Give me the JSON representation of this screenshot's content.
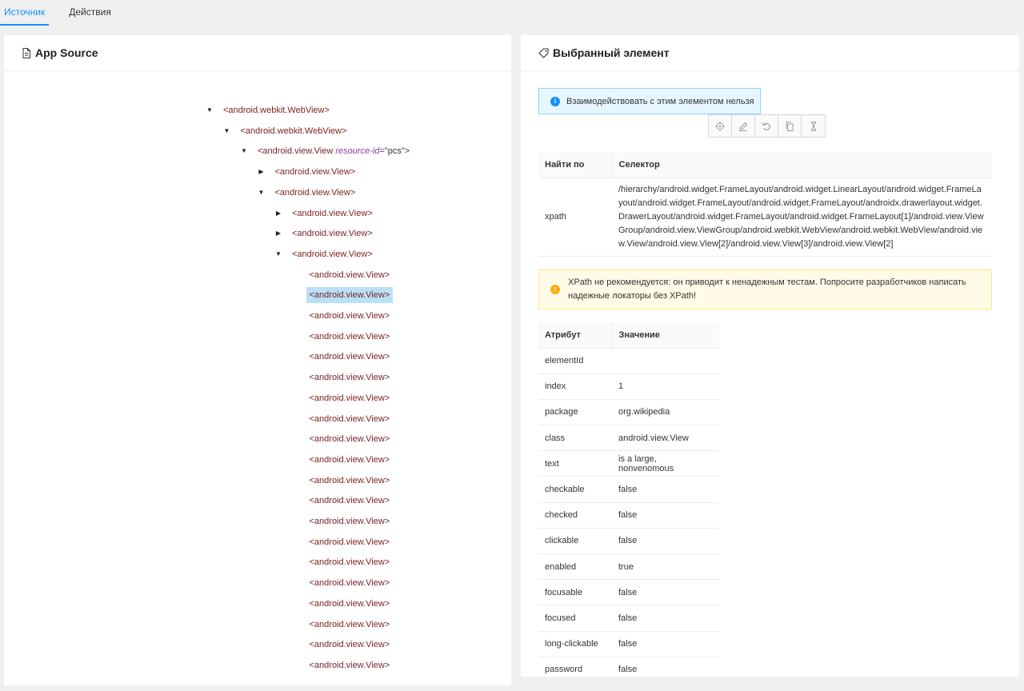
{
  "tabs": [
    {
      "label": "Источник",
      "active": true
    },
    {
      "label": "Действия",
      "active": false
    }
  ],
  "left_panel": {
    "title": "App Source",
    "tree": [
      {
        "tag": "<android.webkit.WebView>",
        "depth": 0,
        "caret": "down"
      },
      {
        "tag": "<android.webkit.WebView>",
        "depth": 1,
        "caret": "down"
      },
      {
        "tag": "<android.view.View",
        "attr_name": "resource-id",
        "attr_value": "=\"pcs\"",
        "close": ">",
        "depth": 2,
        "caret": "down"
      },
      {
        "tag": "<android.view.View>",
        "depth": 3,
        "caret": "right"
      },
      {
        "tag": "<android.view.View>",
        "depth": 3,
        "caret": "down"
      },
      {
        "tag": "<android.view.View>",
        "depth": 4,
        "caret": "right"
      },
      {
        "tag": "<android.view.View>",
        "depth": 4,
        "caret": "right"
      },
      {
        "tag": "<android.view.View>",
        "depth": 4,
        "caret": "down"
      },
      {
        "tag": "<android.view.View>",
        "depth": 5
      },
      {
        "tag": "<android.view.View>",
        "depth": 5,
        "selected": true
      },
      {
        "tag": "<android.view.View>",
        "depth": 5
      },
      {
        "tag": "<android.view.View>",
        "depth": 5
      },
      {
        "tag": "<android.view.View>",
        "depth": 5
      },
      {
        "tag": "<android.view.View>",
        "depth": 5
      },
      {
        "tag": "<android.view.View>",
        "depth": 5
      },
      {
        "tag": "<android.view.View>",
        "depth": 5
      },
      {
        "tag": "<android.view.View>",
        "depth": 5
      },
      {
        "tag": "<android.view.View>",
        "depth": 5
      },
      {
        "tag": "<android.view.View>",
        "depth": 5
      },
      {
        "tag": "<android.view.View>",
        "depth": 5
      },
      {
        "tag": "<android.view.View>",
        "depth": 5
      },
      {
        "tag": "<android.view.View>",
        "depth": 5
      },
      {
        "tag": "<android.view.View>",
        "depth": 5
      },
      {
        "tag": "<android.view.View>",
        "depth": 5
      },
      {
        "tag": "<android.view.View>",
        "depth": 5
      },
      {
        "tag": "<android.view.View>",
        "depth": 5
      },
      {
        "tag": "<android.view.View>",
        "depth": 5
      },
      {
        "tag": "<android.view.View>",
        "depth": 5
      }
    ]
  },
  "right_panel": {
    "title": "Выбранный элемент",
    "info_message": "Взаимодействовать с этим элементом нельзя",
    "toolbar": [
      "crosshair-icon",
      "pencil-icon",
      "undo-icon",
      "copy-icon",
      "hourglass-icon"
    ],
    "selector_table": {
      "headers": [
        "Найти по",
        "Селектор"
      ],
      "rows": [
        {
          "by": "xpath",
          "value": "/hierarchy/android.widget.FrameLayout/android.widget.LinearLayout/android.widget.FrameLayout/android.widget.FrameLayout/android.widget.FrameLayout/androidx.drawerlayout.widget.DrawerLayout/android.widget.FrameLayout/android.widget.FrameLayout[1]/android.view.ViewGroup/android.view.ViewGroup/android.webkit.WebView/android.webkit.WebView/android.view.View/android.view.View[2]/android.view.View[3]/android.view.View[2]"
        }
      ]
    },
    "warning_message": "XPath не рекомендуется: он приводит к ненадежным тестам. Попросите разработчиков написать надежные локаторы без XPath!",
    "attr_table": {
      "headers": [
        "Атрибут",
        "Значение"
      ],
      "rows": [
        {
          "name": "elementId",
          "value": ""
        },
        {
          "name": "index",
          "value": "1"
        },
        {
          "name": "package",
          "value": "org.wikipedia"
        },
        {
          "name": "class",
          "value": "android.view.View"
        },
        {
          "name": "text",
          "value": "is a large, nonvenomous"
        },
        {
          "name": "checkable",
          "value": "false"
        },
        {
          "name": "checked",
          "value": "false"
        },
        {
          "name": "clickable",
          "value": "false"
        },
        {
          "name": "enabled",
          "value": "true"
        },
        {
          "name": "focusable",
          "value": "false"
        },
        {
          "name": "focused",
          "value": "false"
        },
        {
          "name": "long-clickable",
          "value": "false"
        },
        {
          "name": "password",
          "value": "false"
        }
      ]
    }
  }
}
